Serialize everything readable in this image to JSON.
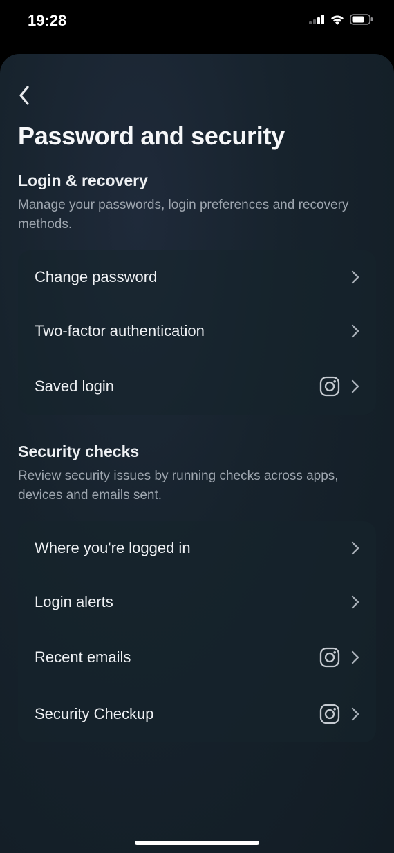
{
  "status": {
    "time": "19:28"
  },
  "page": {
    "title": "Password and security"
  },
  "sections": {
    "login": {
      "title": "Login & recovery",
      "desc": "Manage your passwords, login preferences and recovery methods.",
      "items": {
        "change_password": "Change password",
        "two_factor": "Two-factor authentication",
        "saved_login": "Saved login"
      }
    },
    "security": {
      "title": "Security checks",
      "desc": "Review security issues by running checks across apps, devices and emails sent.",
      "items": {
        "where_logged_in": "Where you're logged in",
        "login_alerts": "Login alerts",
        "recent_emails": "Recent emails",
        "security_checkup": "Security Checkup"
      }
    }
  }
}
